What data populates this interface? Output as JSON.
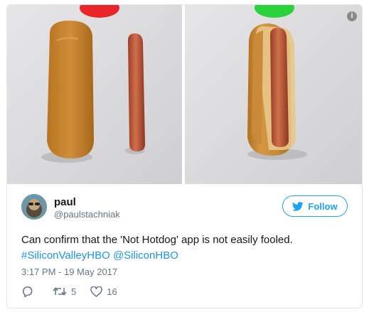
{
  "tweet": {
    "name": "paul",
    "handle": "@paulstachniak",
    "follow_label": "Follow",
    "text_plain": "Can confirm that the 'Not Hotdog' app is not easily fooled.",
    "hashtag": "#SiliconValleyHBO",
    "mention": "@SiliconHBO",
    "timestamp": "3:17 PM - 19 May 2017",
    "retweets": "5",
    "likes": "16"
  },
  "media": {
    "left_photo": "bun-and-sausage-separated",
    "right_photo": "hotdog-assembled",
    "left_indicator_color": "#e8262a",
    "right_indicator_color": "#2bd13b",
    "info_glyph": "i"
  },
  "colors": {
    "accent": "#1da1f2",
    "link": "#1b95e0",
    "muted": "#657786"
  },
  "icons": [
    "info-icon",
    "twitter-bird-icon",
    "reply-icon",
    "retweet-icon",
    "like-icon"
  ]
}
